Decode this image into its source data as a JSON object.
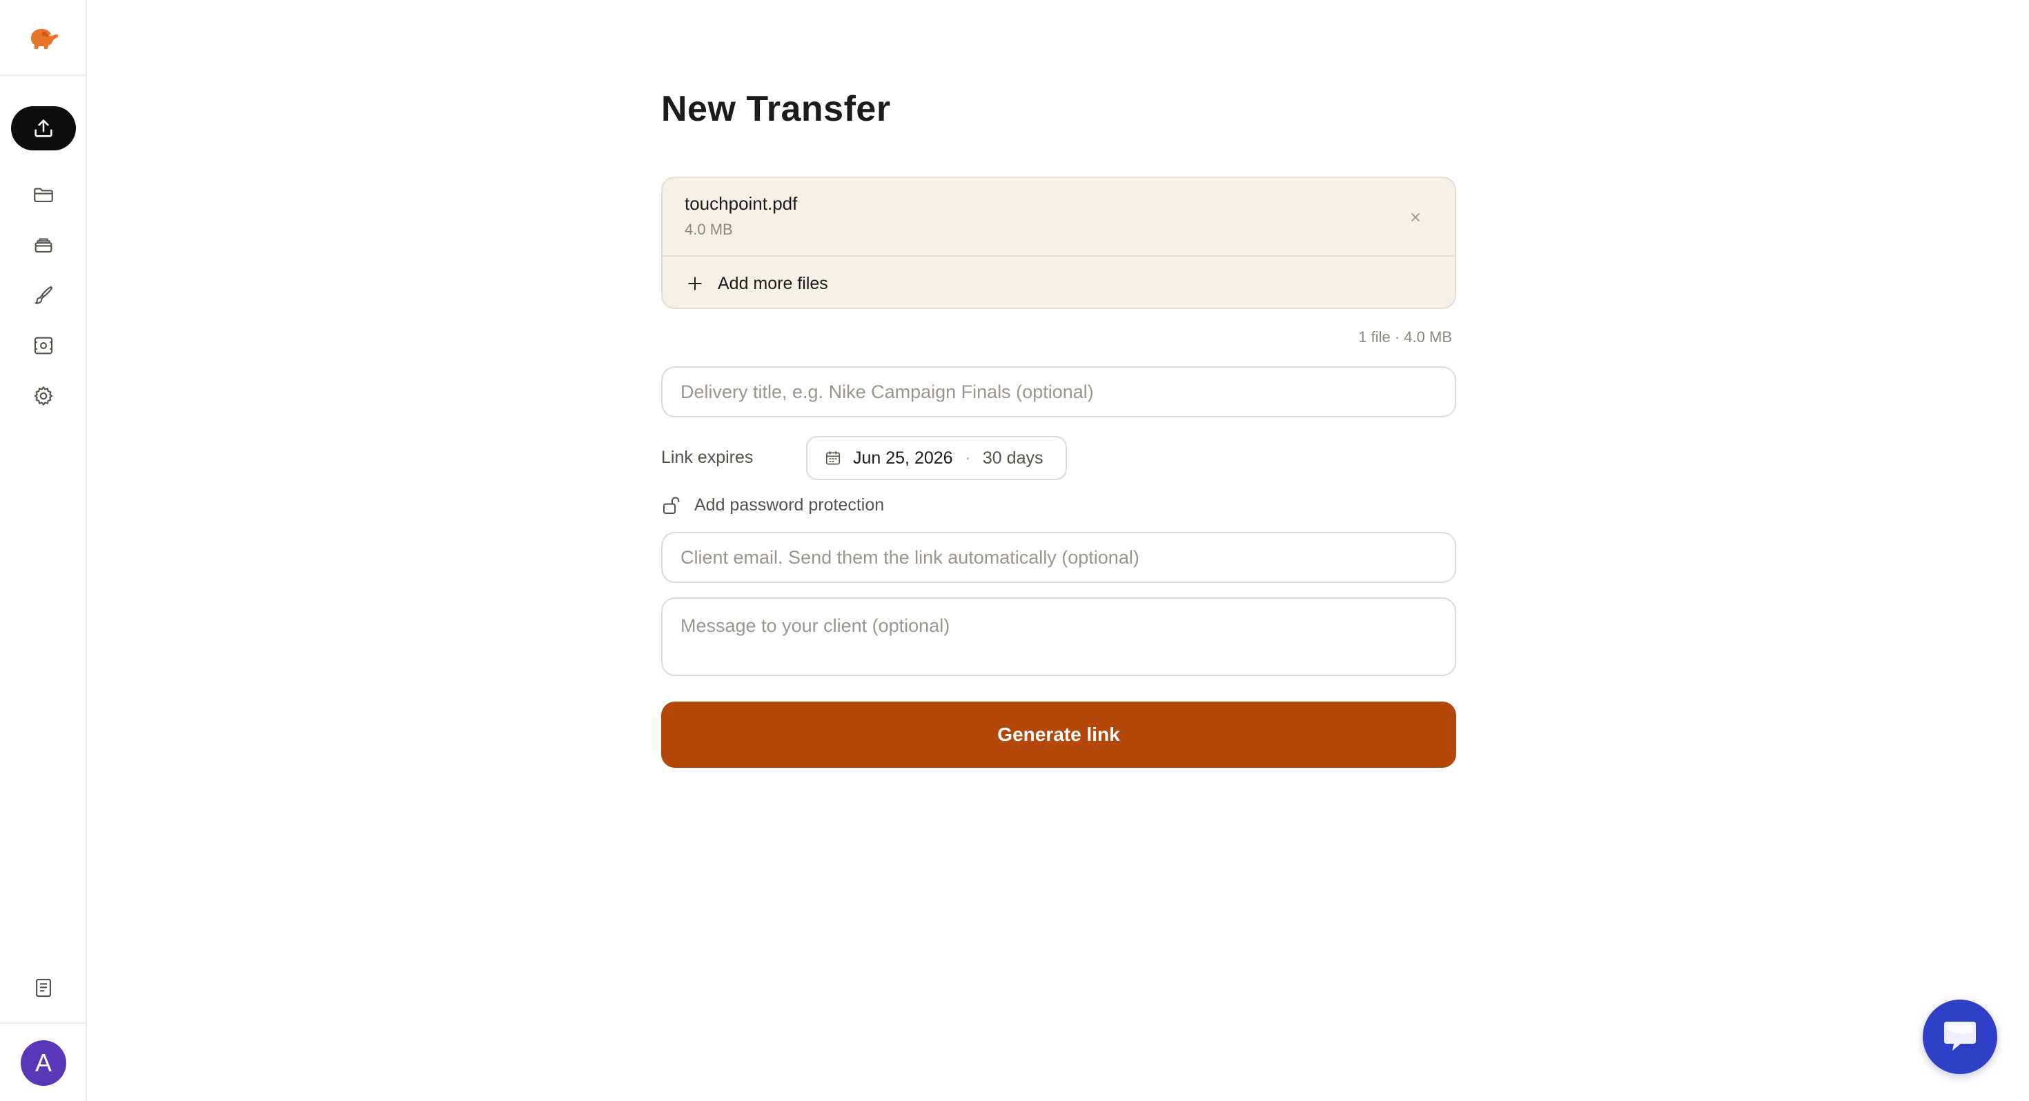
{
  "sidebar": {
    "logo_icon": "elephant-logo-icon",
    "items": [
      {
        "icon": "upload-icon",
        "active": true
      },
      {
        "icon": "folder-icon",
        "active": false
      },
      {
        "icon": "inbox-icon",
        "active": false
      },
      {
        "icon": "brush-icon",
        "active": false
      },
      {
        "icon": "camera-icon",
        "active": false
      },
      {
        "icon": "gear-icon",
        "active": false
      }
    ],
    "bottom_icon": "document-icon",
    "avatar_initial": "A"
  },
  "page": {
    "title": "New Transfer"
  },
  "files": [
    {
      "name": "touchpoint.pdf",
      "size": "4.0 MB"
    }
  ],
  "add_files_label": "Add more files",
  "file_summary": "1 file · 4.0 MB",
  "title_input": {
    "value": "",
    "placeholder": "Delivery title, e.g. Nike Campaign Finals (optional)"
  },
  "expiry": {
    "label": "Link expires",
    "date": "Jun 25, 2026",
    "separator": "·",
    "days": "30 days"
  },
  "password": {
    "label": "Add password protection"
  },
  "email_input": {
    "value": "",
    "placeholder": "Client email. Send them the link automatically (optional)"
  },
  "message_input": {
    "value": "",
    "placeholder": "Message to your client (optional)"
  },
  "generate_button": {
    "label": "Generate link"
  },
  "colors": {
    "accent": "#b4480a",
    "avatar": "#5a36b8",
    "chat": "#2f3fc8",
    "logo": "#e8742a"
  },
  "chat_icon": "chat-bubble-icon"
}
